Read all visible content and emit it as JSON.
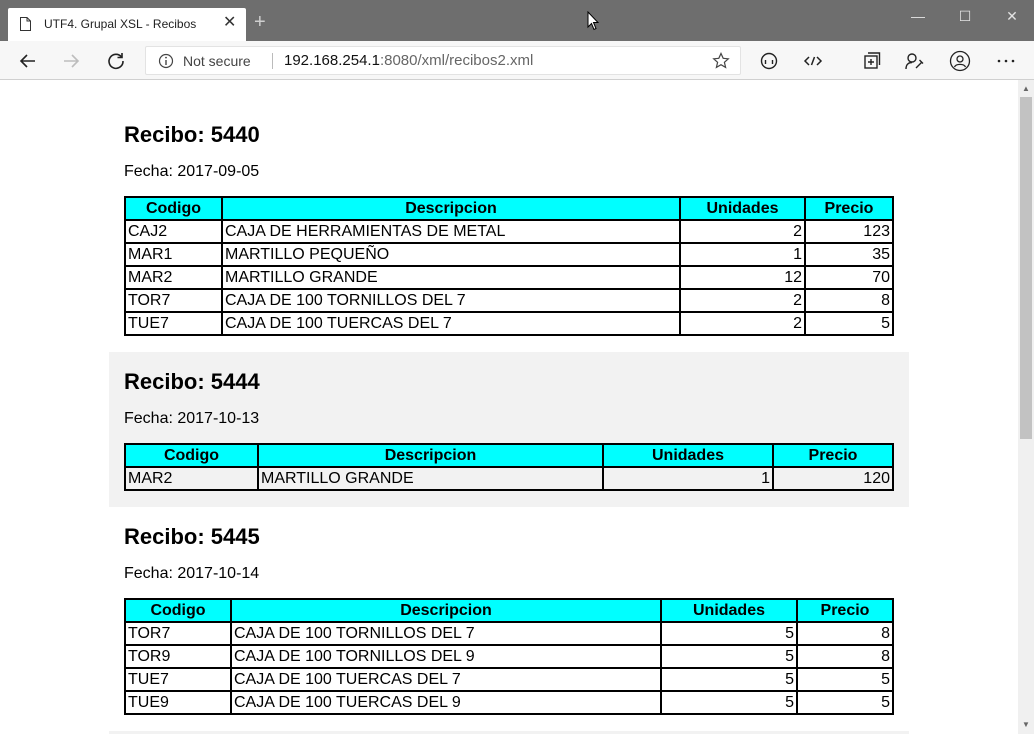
{
  "browser": {
    "tab_title": "UTF4. Grupal XSL - Recibos",
    "not_secure": "Not secure",
    "url_host": "192.168.254.1",
    "url_rest": ":8080/xml/recibos2.xml"
  },
  "recibos": [
    {
      "title": "Recibo: 5440",
      "fecha": "Fecha: 2017-09-05",
      "headers": [
        "Codigo",
        "Descripcion",
        "Unidades",
        "Precio"
      ],
      "rows": [
        [
          "CAJ2",
          "CAJA DE HERRAMIENTAS DE METAL",
          "2",
          "123"
        ],
        [
          "MAR1",
          "MARTILLO PEQUEÑO",
          "1",
          "35"
        ],
        [
          "MAR2",
          "MARTILLO GRANDE",
          "12",
          "70"
        ],
        [
          "TOR7",
          "CAJA DE 100 TORNILLOS DEL 7",
          "2",
          "8"
        ],
        [
          "TUE7",
          "CAJA DE 100 TUERCAS DEL 7",
          "2",
          "5"
        ]
      ]
    },
    {
      "title": "Recibo: 5444",
      "fecha": "Fecha: 2017-10-13",
      "headers": [
        "Codigo",
        "Descripcion",
        "Unidades",
        "Precio"
      ],
      "rows": [
        [
          "MAR2",
          "MARTILLO GRANDE",
          "1",
          "120"
        ]
      ]
    },
    {
      "title": "Recibo: 5445",
      "fecha": "Fecha: 2017-10-14",
      "headers": [
        "Codigo",
        "Descripcion",
        "Unidades",
        "Precio"
      ],
      "rows": [
        [
          "TOR7",
          "CAJA DE 100 TORNILLOS DEL 7",
          "5",
          "8"
        ],
        [
          "TOR9",
          "CAJA DE 100 TORNILLOS DEL 9",
          "5",
          "8"
        ],
        [
          "TUE7",
          "CAJA DE 100 TUERCAS DEL 7",
          "5",
          "5"
        ],
        [
          "TUE9",
          "CAJA DE 100 TUERCAS DEL 9",
          "5",
          "5"
        ]
      ]
    }
  ],
  "icons": {
    "back": "back-arrow-icon",
    "forward": "forward-arrow-icon",
    "refresh": "refresh-icon",
    "info": "info-icon",
    "star": "favorite-star-icon",
    "reader": "reading-view-icon",
    "devtools": "code-icon",
    "collections": "collections-icon",
    "feedback": "feedback-icon",
    "profile": "profile-icon",
    "more": "more-icon"
  },
  "colors": {
    "header_bg": "#00ffff",
    "alt_row_bg": "#f2f2f2",
    "titlebar": "#6e6e6e"
  }
}
